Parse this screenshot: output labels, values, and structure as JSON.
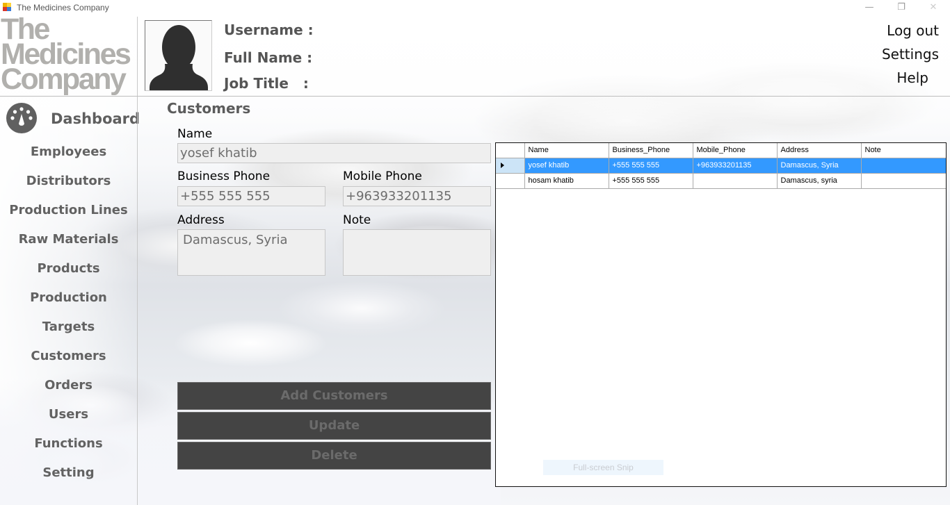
{
  "window": {
    "title": "The Medicines Company",
    "controls": {
      "minimize": "—",
      "restore": "❐",
      "close": "✕"
    }
  },
  "logo": {
    "lines": [
      "The",
      "Medicines",
      "Company"
    ]
  },
  "header": {
    "avatar_icon": "user-silhouette-icon",
    "user_labels": {
      "username": "Username :",
      "full_name": "Full Name :",
      "job_title": "Job Title   :"
    },
    "links": {
      "logout": "Log out",
      "settings": "Settings",
      "help": "Help"
    }
  },
  "sidebar": {
    "dashboard": {
      "label": "Dashboard",
      "icon": "dashboard-gauge-icon"
    },
    "items": [
      {
        "label": "Employees"
      },
      {
        "label": "Distributors"
      },
      {
        "label": "Production Lines"
      },
      {
        "label": "Raw Materials"
      },
      {
        "label": "Products"
      },
      {
        "label": "Production"
      },
      {
        "label": "Targets"
      },
      {
        "label": "Customers"
      },
      {
        "label": "Orders"
      },
      {
        "label": "Users"
      },
      {
        "label": "Functions"
      },
      {
        "label": "Setting"
      }
    ]
  },
  "form": {
    "title": "Customers",
    "name": {
      "label": "Name",
      "value": "yosef khatib"
    },
    "business_phone": {
      "label": "Business Phone",
      "value": "+555 555 555"
    },
    "mobile_phone": {
      "label": "Mobile Phone",
      "value": "+963933201135"
    },
    "address": {
      "label": "Address",
      "value": "Damascus, Syria"
    },
    "note": {
      "label": "Note",
      "value": ""
    },
    "buttons": {
      "add": "Add Customers",
      "update": "Update",
      "delete": "Delete"
    }
  },
  "grid": {
    "columns": [
      "Name",
      "Business_Phone",
      "Mobile_Phone",
      "Address",
      "Note"
    ],
    "rows": [
      {
        "selected": true,
        "cells": [
          "yosef khatib",
          "+555 555 555",
          "+963933201135",
          "Damascus, Syria",
          ""
        ]
      },
      {
        "selected": false,
        "cells": [
          "hosam khatib",
          "+555 555 555",
          "",
          "Damascus, syria",
          ""
        ]
      }
    ],
    "selection_color": "#3399ff"
  },
  "overlay": {
    "snip_label": "Full-screen Snip"
  }
}
